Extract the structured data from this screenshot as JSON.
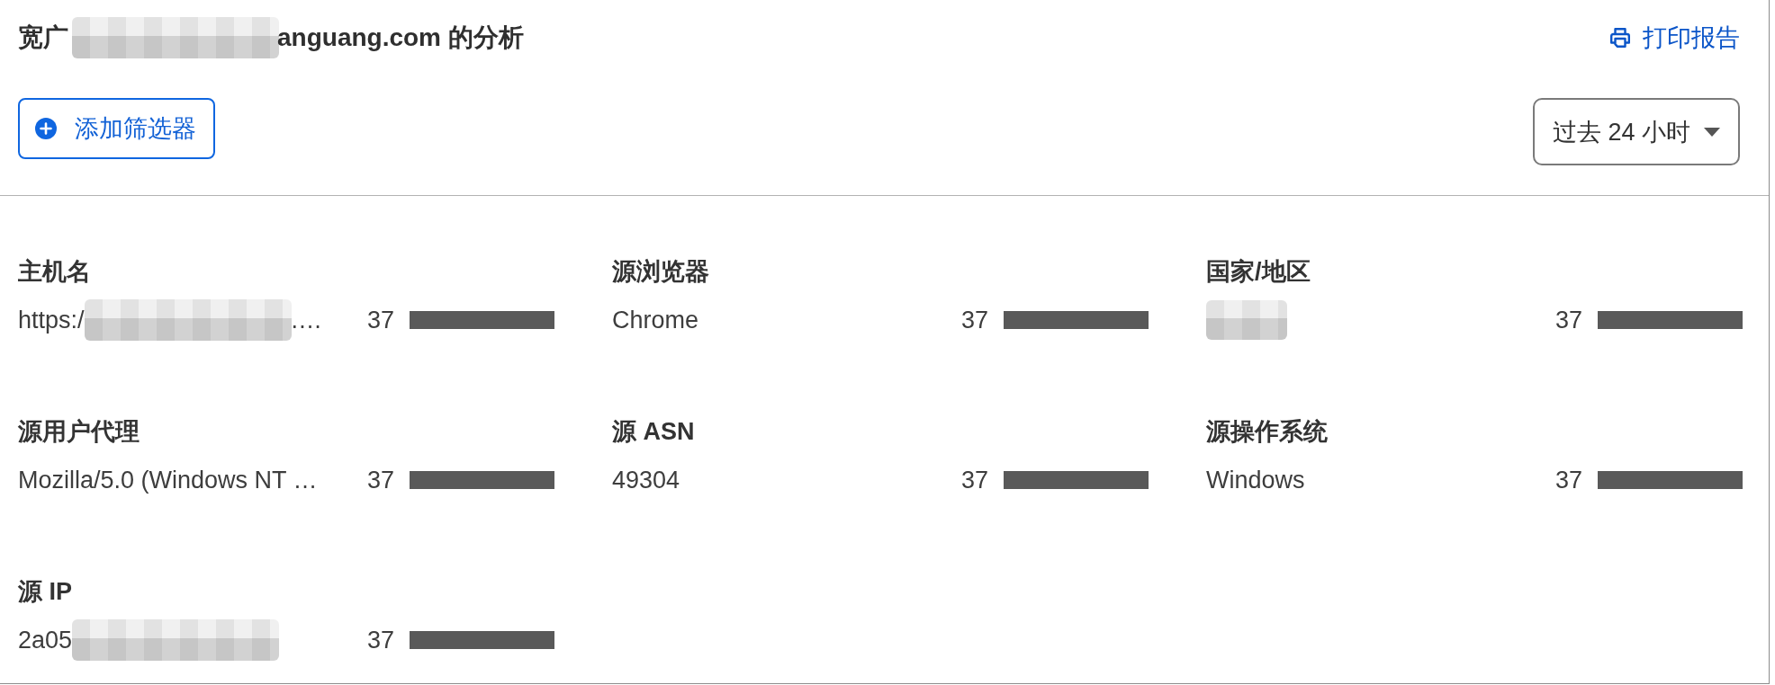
{
  "header": {
    "title": {
      "start": "宽广",
      "redacted": true,
      "end": "anguang.com 的分析"
    },
    "print_link": {
      "label": "打印报告"
    }
  },
  "toolbar": {
    "add_filter": {
      "label": "添加筛选器"
    },
    "time_range": {
      "value": "过去 24 小时"
    }
  },
  "panels": [
    {
      "title": "主机名",
      "rows": [
        {
          "value": "https:/",
          "redacted": true,
          "value_end": ".…",
          "count": "37"
        }
      ]
    },
    {
      "title": "源浏览器",
      "rows": [
        {
          "value": "Chrome",
          "redacted": false,
          "count": "37"
        }
      ]
    },
    {
      "title": "国家/地区",
      "rows": [
        {
          "redacted": true,
          "count": "37"
        }
      ]
    },
    {
      "title": "源用户代理",
      "rows": [
        {
          "value": "Mozilla/5.0 (Windows NT …",
          "redacted": false,
          "count": "37"
        }
      ]
    },
    {
      "title": "源 ASN",
      "rows": [
        {
          "value": "49304",
          "redacted": false,
          "count": "37"
        }
      ]
    },
    {
      "title": "源操作系统",
      "rows": [
        {
          "value": "Windows",
          "redacted": false,
          "count": "37"
        }
      ]
    },
    {
      "title": "源 IP",
      "rows": [
        {
          "value": "2a05",
          "redacted": true,
          "count": "37"
        }
      ]
    }
  ]
}
